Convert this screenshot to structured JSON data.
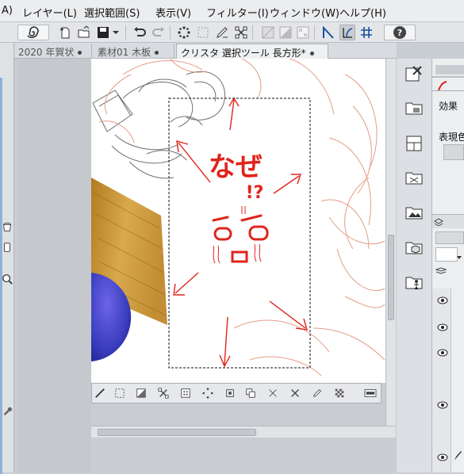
{
  "menu": {
    "items": [
      "A)",
      "レイヤー(L)",
      "選択範囲(S)",
      "表示(V)",
      "フィルター(I)",
      "ウィンドウ(W)",
      "ヘルプ(H)"
    ]
  },
  "tabs": [
    {
      "label": "2020 年賀状"
    },
    {
      "label": "素材01 木板"
    },
    {
      "label": "クリスタ 選択ツール 長方形*"
    }
  ],
  "canvas": {
    "annotation_line1": "なぜ",
    "annotation_line2": "!?"
  },
  "right_panel": {
    "tab_label": "効果",
    "field_label": "表現色"
  },
  "colors": {
    "annotation_red": "#e0241c",
    "sketch_salmon": "#e39279",
    "sketch_gray": "#555555",
    "sphere_blue": "#3c3fc0",
    "wood": "#c79436",
    "selection": "#111111"
  },
  "icons": {
    "toolbar": [
      "spiral-icon",
      "new-icon",
      "open-icon",
      "save-icon",
      "undo-icon",
      "redo-icon",
      "marching-ants-icon",
      "deselect-icon",
      "pen-clear-icon",
      "transform-icon",
      "grid-icon",
      "ruler-icon",
      "snap-ruler-icon",
      "snap-special-icon",
      "snap-grid-icon",
      "help-icon"
    ]
  }
}
